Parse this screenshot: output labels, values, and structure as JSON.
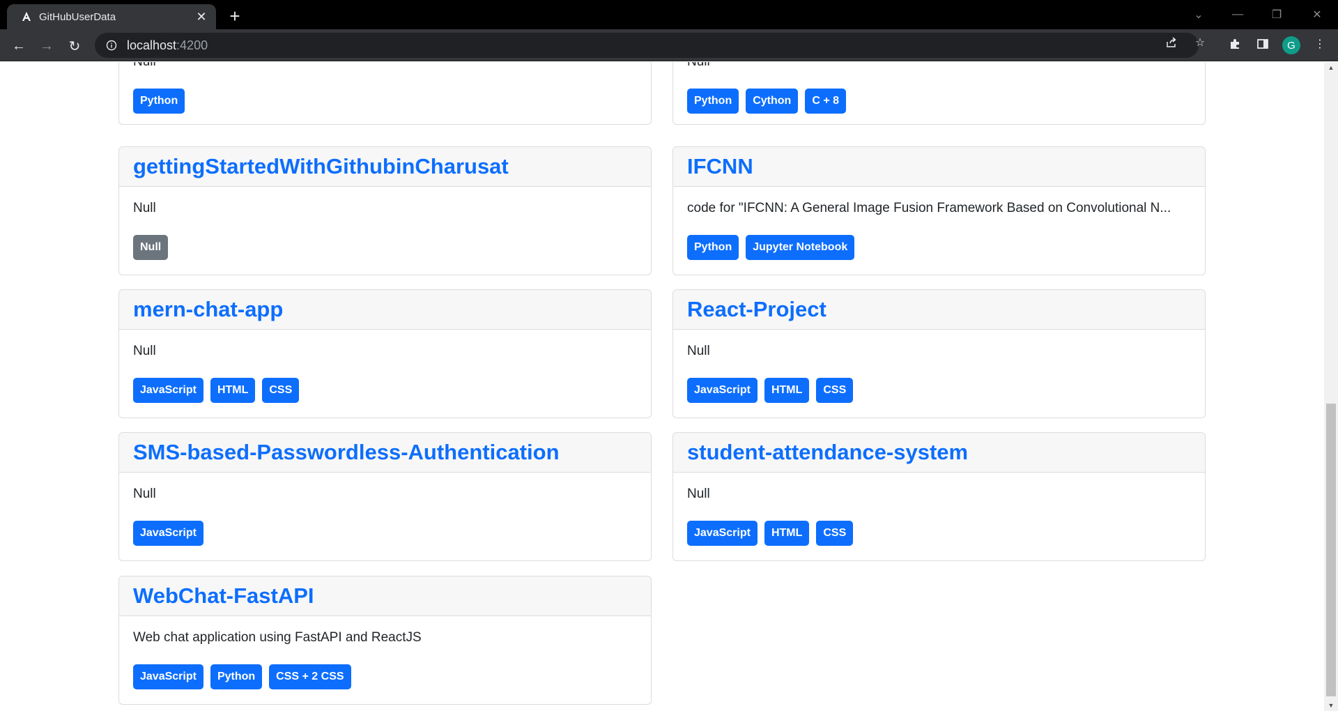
{
  "browser": {
    "tab_title": "GitHubUserData",
    "url_host": "localhost",
    "url_port": ":4200",
    "profile_initial": "G"
  },
  "repos": [
    {
      "name": "",
      "description": "Null",
      "languages": [
        {
          "label": "Python",
          "color": "#0d6efd"
        }
      ]
    },
    {
      "name": "",
      "description": "Null",
      "languages": [
        {
          "label": "Python",
          "color": "#0d6efd"
        },
        {
          "label": "Cython",
          "color": "#0d6efd"
        },
        {
          "label": "C + 8",
          "color": "#0d6efd"
        }
      ]
    },
    {
      "name": "gettingStartedWithGithubinCharusat",
      "description": "Null",
      "languages": [
        {
          "label": "Null",
          "color": "#6c757d"
        }
      ]
    },
    {
      "name": "IFCNN",
      "description": "code for \"IFCNN: A General Image Fusion Framework Based on Convolutional N...",
      "languages": [
        {
          "label": "Python",
          "color": "#0d6efd"
        },
        {
          "label": "Jupyter Notebook",
          "color": "#0d6efd"
        }
      ]
    },
    {
      "name": "mern-chat-app",
      "description": "Null",
      "languages": [
        {
          "label": "JavaScript",
          "color": "#0d6efd"
        },
        {
          "label": "HTML",
          "color": "#0d6efd"
        },
        {
          "label": "CSS",
          "color": "#0d6efd"
        }
      ]
    },
    {
      "name": "React-Project",
      "description": "Null",
      "languages": [
        {
          "label": "JavaScript",
          "color": "#0d6efd"
        },
        {
          "label": "HTML",
          "color": "#0d6efd"
        },
        {
          "label": "CSS",
          "color": "#0d6efd"
        }
      ]
    },
    {
      "name": "SMS-based-Passwordless-Authentication",
      "description": "Null",
      "languages": [
        {
          "label": "JavaScript",
          "color": "#0d6efd"
        }
      ]
    },
    {
      "name": "student-attendance-system",
      "description": "Null",
      "languages": [
        {
          "label": "JavaScript",
          "color": "#0d6efd"
        },
        {
          "label": "HTML",
          "color": "#0d6efd"
        },
        {
          "label": "CSS",
          "color": "#0d6efd"
        }
      ]
    },
    {
      "name": "WebChat-FastAPI",
      "description": "Web chat application using FastAPI and ReactJS",
      "languages": [
        {
          "label": "JavaScript",
          "color": "#0d6efd"
        },
        {
          "label": "Python",
          "color": "#0d6efd"
        },
        {
          "label": "CSS + 2 CSS",
          "color": "#0d6efd"
        }
      ]
    }
  ]
}
